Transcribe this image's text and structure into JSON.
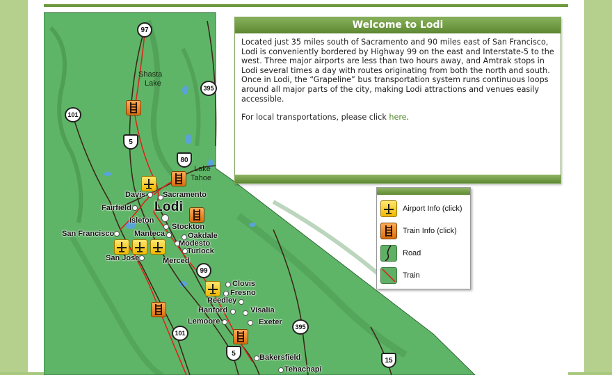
{
  "welcome": {
    "title": "Welcome to Lodi",
    "paragraph1": "Located just 35 miles south of Sacramento and 90 miles east of San Francisco, Lodi is conveniently bordered by Highway 99 on the east and Interstate-5 to the west. Three major airports are less than two hours away, and Amtrak stops in Lodi several times a day with routes originating from both the north and south. Once in Lodi, the “Grapeline” bus transportation system runs continuous loops around all major parts of the city, making Lodi attractions and venues easily accessible.",
    "paragraph2_prefix": "For local transportations, please click ",
    "paragraph2_link": "here",
    "paragraph2_suffix": "."
  },
  "legend": {
    "items": [
      {
        "label": "Airport Info (click)",
        "icon": "airplane-icon"
      },
      {
        "label": "Train Info (click)",
        "icon": "train-icon"
      },
      {
        "label": "Road",
        "icon": "road-icon"
      },
      {
        "label": "Train",
        "icon": "train-line-icon"
      }
    ]
  },
  "map": {
    "cities": {
      "shasta_lake_1": "Shasta",
      "shasta_lake_2": "Lake",
      "lake_tahoe_1": "Lake",
      "lake_tahoe_2": "Tahoe",
      "davis": "Davis",
      "sacramento": "Sacramento",
      "fairfield": "Fairfield",
      "lodi": "Lodi",
      "isleton": "Isleton",
      "stockton": "Stockton",
      "san_francisco": "San Francisco",
      "manteca": "Manteca",
      "oakdale": "Oakdale",
      "modesto": "Modesto",
      "turlock": "Turlock",
      "san_jose": "San Jose",
      "merced": "Merced",
      "clovis": "Clovis",
      "fresno": "Fresno",
      "reedley": "Reedley",
      "hanford": "Hanford",
      "visalia": "Visalia",
      "lemoore": "Lemoore",
      "exeter": "Exeter",
      "bakersfield": "Bakersfield",
      "tehachapi": "Tehachapi"
    },
    "highways": {
      "h97": "97",
      "h395a": "395",
      "h101a": "101",
      "h5a": "5",
      "h80": "80",
      "h99": "99",
      "h395b": "395",
      "h101b": "101",
      "h5b": "5",
      "h15": "15"
    },
    "colors": {
      "land": "#5fb567",
      "road": "#3a2a1a",
      "rail": "#d9261c",
      "water": "#5aa3d8"
    }
  }
}
